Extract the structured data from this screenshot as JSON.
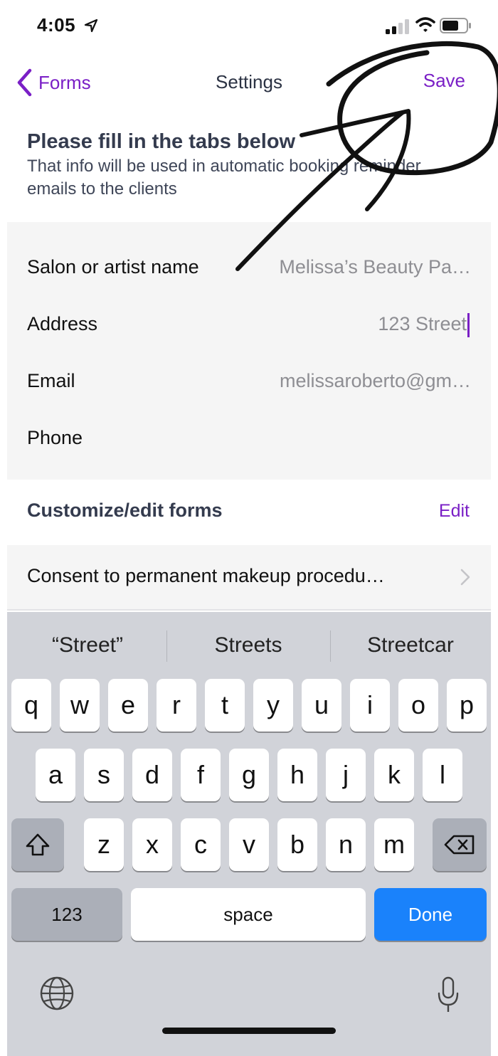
{
  "status_bar": {
    "time": "4:05",
    "icons": [
      "location-arrow-icon",
      "signal-icon",
      "wifi-icon",
      "battery-icon"
    ]
  },
  "nav": {
    "back_label": "Forms",
    "title": "Settings",
    "save_label": "Save"
  },
  "info": {
    "title": "Please fill in the tabs below",
    "subtitle": "That info will be used in automatic booking reminder emails to the clients"
  },
  "fields": [
    {
      "label": "Salon or artist name",
      "value": "Melissa’s Beauty Pa…"
    },
    {
      "label": "Address",
      "value": "123 Street"
    },
    {
      "label": "Email",
      "value": "melissaroberto@gm…"
    },
    {
      "label": "Phone",
      "value": ""
    }
  ],
  "customize": {
    "title": "Customize/edit forms",
    "edit_label": "Edit"
  },
  "forms": [
    {
      "label": "Consent to permanent makeup procedu…"
    }
  ],
  "keyboard": {
    "suggestions": [
      "“Street”",
      "Streets",
      "Streetcar"
    ],
    "row1": [
      "q",
      "w",
      "e",
      "r",
      "t",
      "y",
      "u",
      "i",
      "o",
      "p"
    ],
    "row2": [
      "a",
      "s",
      "d",
      "f",
      "g",
      "h",
      "j",
      "k",
      "l"
    ],
    "row3": [
      "z",
      "x",
      "c",
      "v",
      "b",
      "n",
      "m"
    ],
    "numbers_label": "123",
    "space_label": "space",
    "done_label": "Done"
  },
  "colors": {
    "accent": "#7a1fc6",
    "done_key": "#1a82fb",
    "panel": "#f5f5f5",
    "keyboard_bg": "#d1d3d9"
  }
}
